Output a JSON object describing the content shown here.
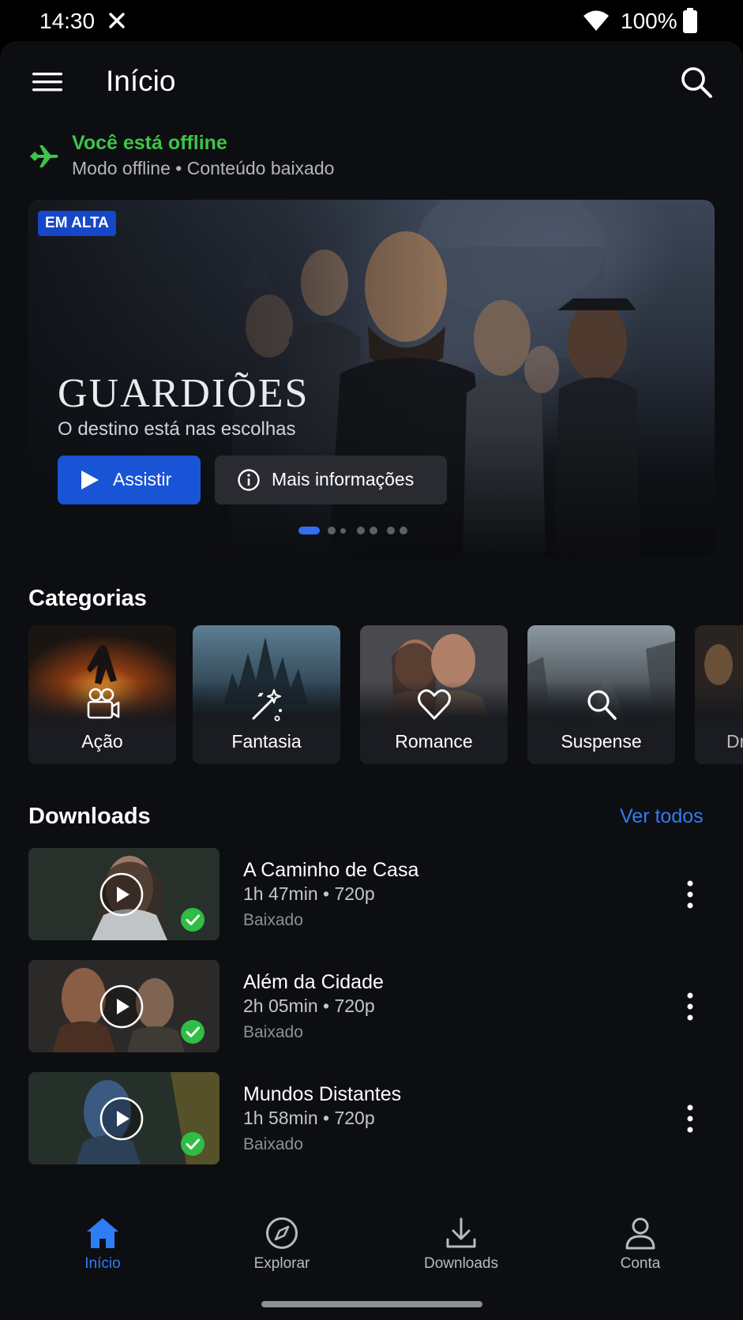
{
  "status_bar": {
    "time": "14:30",
    "battery": "100%",
    "icons": [
      "x-icon",
      "wifi-icon",
      "battery-icon"
    ]
  },
  "header": {
    "title": "Início",
    "icons": [
      "menu-icon",
      "search-icon"
    ]
  },
  "offline": {
    "title": "Você está offline",
    "subtitle": "Modo offline • Conteúdo baixado",
    "icon": "airplane-icon",
    "color": "#3ec44a"
  },
  "hero": {
    "badge": "EM ALTA",
    "title": "GUARDIÕES",
    "tagline": "O destino está nas escolhas",
    "primary_button": "Assistir",
    "secondary_button": "Mais informações",
    "carousel_slides": 7,
    "carousel_active": 1
  },
  "categories": {
    "title": "Categorias",
    "items": [
      {
        "label": "Ação",
        "icon": "movie-camera-icon"
      },
      {
        "label": "Fantasia",
        "icon": "magic-wand-icon"
      },
      {
        "label": "Romance",
        "icon": "heart-icon"
      },
      {
        "label": "Suspense",
        "icon": "search-icon"
      },
      {
        "label": "Dr",
        "icon": ""
      }
    ]
  },
  "downloads": {
    "title": "Downloads",
    "see_all": "Ver todos",
    "items": [
      {
        "title": "A Caminho de Casa",
        "meta": "1h 47min • 720p",
        "status": "Baixado"
      },
      {
        "title": "Além da Cidade",
        "meta": "2h 05min • 720p",
        "status": "Baixado"
      },
      {
        "title": "Mundos Distantes",
        "meta": "1h 58min • 720p",
        "status": "Baixado"
      }
    ]
  },
  "bottom_nav": {
    "items": [
      {
        "label": "Início",
        "icon": "home-icon",
        "active": true
      },
      {
        "label": "Explorar",
        "icon": "compass-icon",
        "active": false
      },
      {
        "label": "Downloads",
        "icon": "download-icon",
        "active": false
      },
      {
        "label": "Conta",
        "icon": "user-icon",
        "active": false
      }
    ]
  },
  "colors": {
    "accent": "#2f7df5",
    "primary_button": "#1a54d6",
    "success": "#3ec44a",
    "background": "#0d0e11"
  }
}
